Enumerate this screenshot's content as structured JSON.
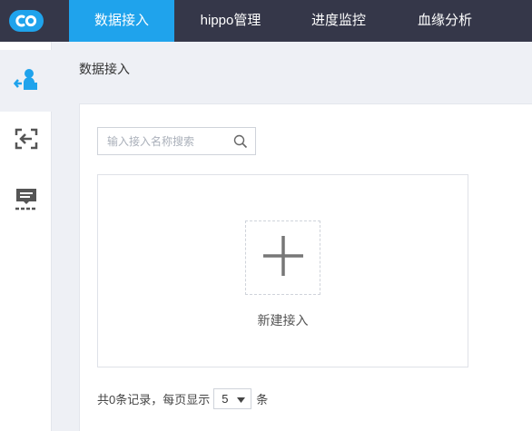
{
  "colors": {
    "accent": "#1fa3ec",
    "topbar": "#353749",
    "background": "#eef0f5"
  },
  "nav": {
    "items": [
      {
        "label": "数据接入",
        "active": true
      },
      {
        "label": "hippo管理",
        "active": false
      },
      {
        "label": "进度监控",
        "active": false
      },
      {
        "label": "血缘分析",
        "active": false
      }
    ]
  },
  "sidebar": {
    "items": [
      {
        "icon": "user-import-icon",
        "active": true
      },
      {
        "icon": "exit-arrow-icon",
        "active": false
      },
      {
        "icon": "monitor-list-icon",
        "active": false
      }
    ]
  },
  "page": {
    "title": "数据接入"
  },
  "search": {
    "placeholder": "输入接入名称搜索"
  },
  "empty_state": {
    "add_label": "新建接入"
  },
  "pagination": {
    "summary_prefix": "共0条记录，每页显示",
    "page_size": "5",
    "suffix": "条"
  }
}
